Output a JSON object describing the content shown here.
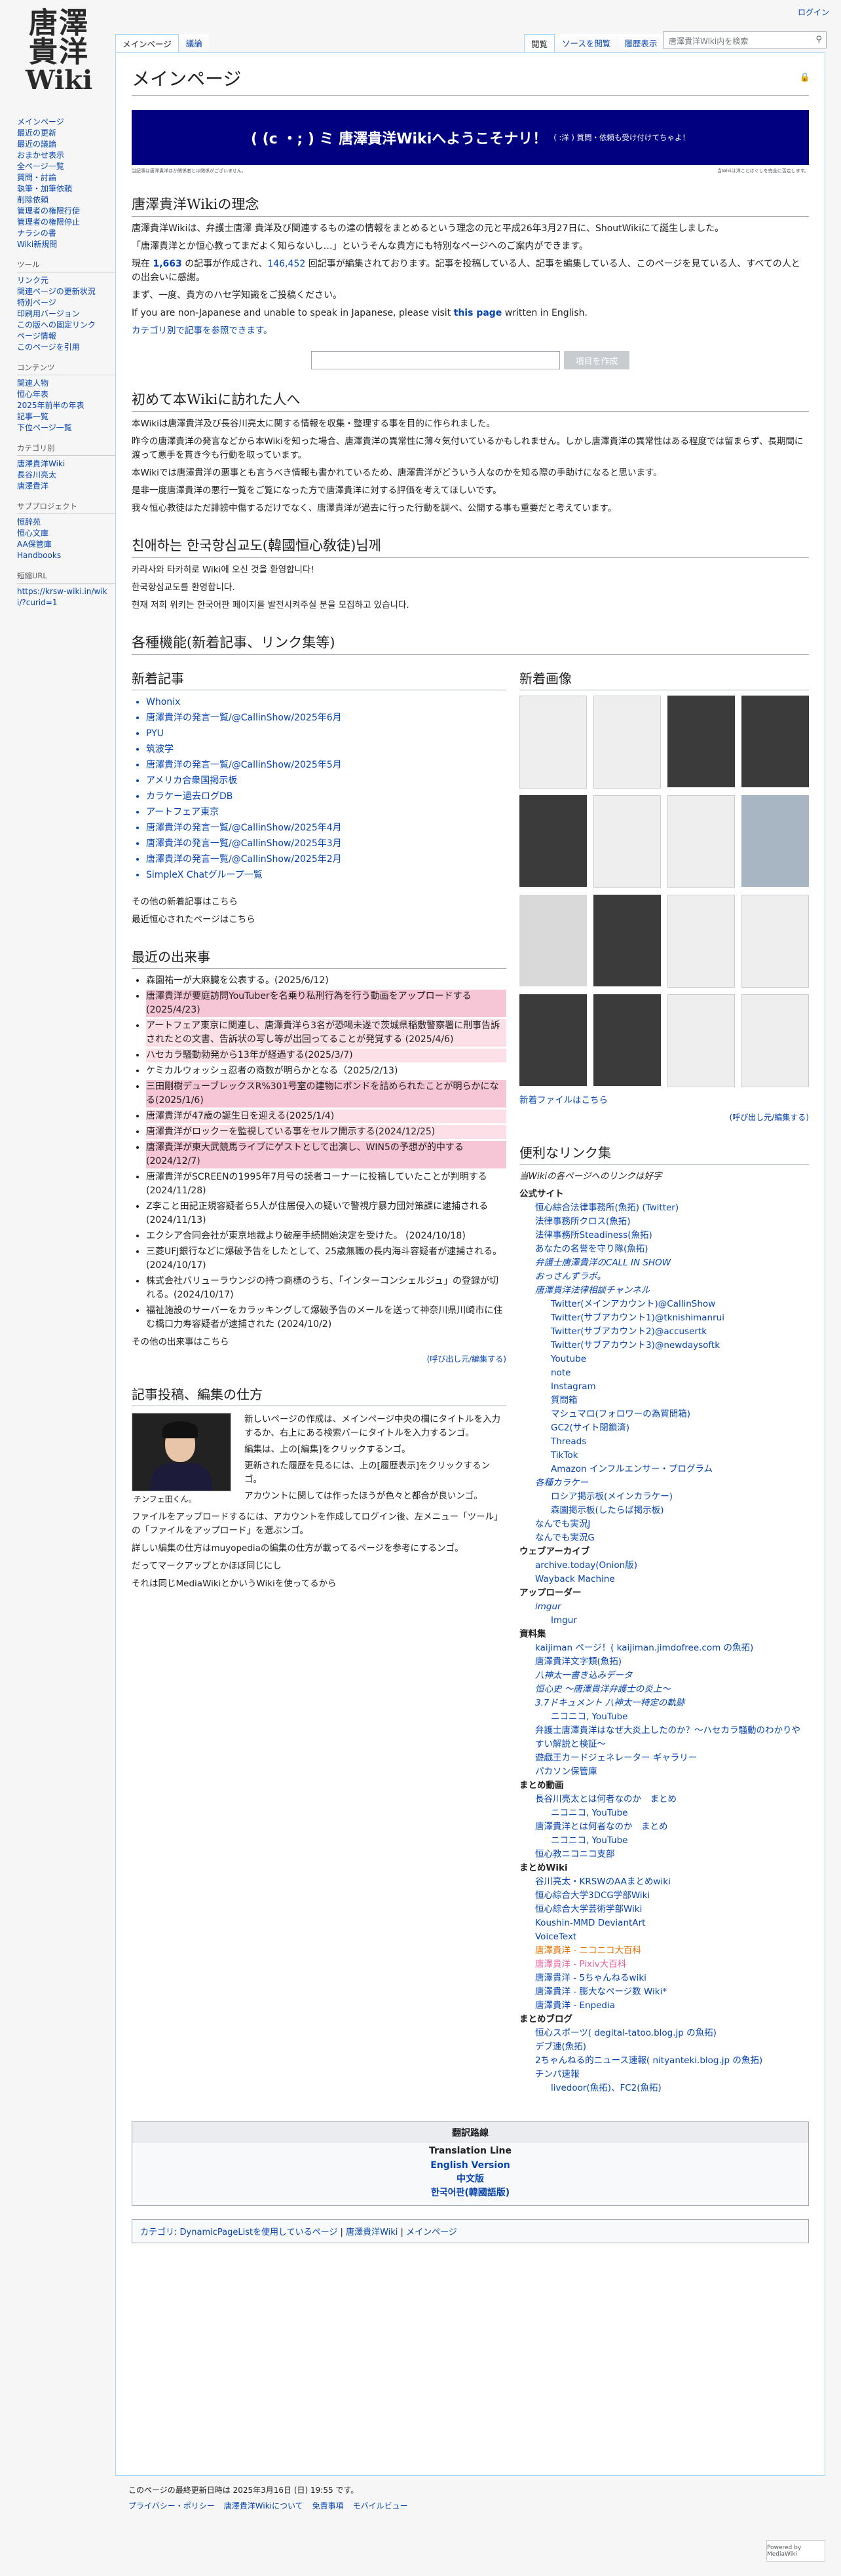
{
  "logo": {
    "line1": "唐澤",
    "line2": "貴洋",
    "line3": "Wiki"
  },
  "personal": {
    "login": "ログイン"
  },
  "tabs": {
    "left": [
      "メインページ",
      "議論"
    ],
    "right": [
      "閲覧",
      "ソースを閲覧",
      "履歴表示"
    ]
  },
  "search": {
    "placeholder": "唐澤貴洋Wiki内を検索"
  },
  "sidebar": {
    "nav": [
      "メインページ",
      "最近の更新",
      "最近の議論",
      "おまかせ表示",
      "全ページ一覧",
      "質問・討論",
      "執筆・加筆依頼",
      "削除依頼",
      "管理者の権限行使",
      "管理者の権限停止",
      "ナラシの書",
      "Wiki新規問"
    ],
    "tools_title": "ツール",
    "tools": [
      "リンク元",
      "関連ページの更新状況",
      "特別ページ",
      "印刷用バージョン",
      "この版への固定リンク",
      "ページ情報",
      "このページを引用"
    ],
    "content_title": "コンテンツ",
    "content": [
      "関連人物",
      "恒心年表",
      "2025年前半の年表",
      "記事一覧",
      "下位ページ一覧"
    ],
    "cat_title": "カテゴリ別",
    "cats": [
      "唐澤貴洋Wiki",
      "長谷川亮太",
      "唐澤貴洋"
    ],
    "sub_title": "サブプロジェクト",
    "subs": [
      "恒辞苑",
      "恒心文庫",
      "AA保管庫",
      "Handbooks"
    ],
    "short_title": "短縮URL",
    "short": "https://krsw-wiki.in/wiki/?curid=1"
  },
  "page": {
    "title": "メインページ",
    "banner_main": "( (c ・; ) ミ 唐澤貴洋Wikiへようこそナリ！",
    "banner_sub": "( :洋 ) 質問・依頼も受け付けてちゃよ！",
    "tiny_left": "当記事は唐澤貴洋ほか関係者とは関係がございません。",
    "tiny_right": "当Wikiは洋ことほぐしを完全に否定します。"
  },
  "philosophy": {
    "heading": "唐澤貴洋Wikiの理念",
    "p1": "唐澤貴洋Wikiは、弁護士唐澤 貴洋及び関連するもの達の情報をまとめるという理念の元と平成26年3月27日に、ShoutWikiにて誕生しました。",
    "p2": "「唐澤貴洋とか恒心教ってまだよく知らないし…」というそんな貴方にも特別なページへのご案内ができます。",
    "p3_a": "現在 ",
    "count_articles": "1,663",
    "p3_b": " の記事が作成され、",
    "count_edits": "146,452",
    "p3_c": " 回記事が編集されております。記事を投稿している人、記事を編集している人、このページを見ている人、すべての人との出会いに感謝。",
    "p4": "まず、一度、貴方のハセ学知識をご投稿ください。",
    "p5_a": "If you are non-Japanese and unable to speak in Japanese, please visit ",
    "p5_link": "this page",
    "p5_b": " written in English.",
    "cat_link": "カテゴリ別で記事を参照できます。",
    "create_btn": "項目を作成"
  },
  "first": {
    "heading": "初めて本Wikiに訪れた人へ",
    "p1": "本Wikiは唐澤貴洋及び長谷川亮太に関する情報を収集・整理する事を目的に作られました。",
    "p2": "昨今の唐澤貴洋の発言などから本Wikiを知った場合、唐澤貴洋の異常性に薄々気付いているかもしれません。しかし唐澤貴洋の異常性はある程度では留まらず、長期間に渡って悪手を貫き今も行動を取っています。",
    "p3": "本Wikiでは唐澤貴洋の悪事とも言うべき情報も書かれているため、唐澤貴洋がどういう人なのかを知る際の手助けになると思います。",
    "p4": "是非一度唐澤貴洋の悪行一覧をご覧になった方で唐澤貴洋に対する評価を考えてほしいです。",
    "p5": "我々恒心教徒はただ誹謗中傷するだけでなく、唐澤貴洋が過去に行った行動を調べ、公開する事も重要だと考えています。"
  },
  "korean": {
    "heading": "친애하는 한국항심교도(韓國恒心敎徒)님께",
    "p1": "카라사와 타카히로 Wiki에 오신 것을 환영합니다!",
    "p2": "한국항심교도를 환영합니다.",
    "p3": "현재 저희 위키는 한국어판 페이지를 발전시켜주실 분을 모집하고 있습니다."
  },
  "features": {
    "heading": "各種機能(新着記事、リンク集等)",
    "new_heading": "新着記事",
    "new_items": [
      "Whonix",
      "唐澤貴洋の発言一覧/@CallinShow/2025年6月",
      "PYU",
      "筑波学",
      "唐澤貴洋の発言一覧/@CallinShow/2025年5月",
      "アメリカ合衆国掲示板",
      "カラケー過去ログDB",
      "アートフェア東京",
      "唐澤貴洋の発言一覧/@CallinShow/2025年4月",
      "唐澤貴洋の発言一覧/@CallinShow/2025年3月",
      "唐澤貴洋の発言一覧/@CallinShow/2025年2月",
      "SimpleX Chatグループ一覧"
    ],
    "new_other": "その他の新着記事はこちら",
    "new_other2": "最近恒心されたページはこちら",
    "events_heading": "最近の出来事",
    "events": [
      "森園祐一が大麻臓を公表する。(2025/6/12)",
      "唐澤貴洋が要庭訪問YouTuberを名乗り私刑行為を行う動画をアップロードする (2025/4/23)",
      "アートフェア東京に関連し、唐澤貴洋ら3名が恐喝未遂で茨城県稲敷警察署に刑事告訴されたとの文書、告訴状の写し等が出回ってることが発覚する (2025/4/6)",
      "ハセカラ騒動勃発から13年が経過する(2025/3/7)",
      "ケミカルウォッシュ忍者の商数が明らかとなる（2025/2/13)",
      "三田剛樹デューブレックスR%301号室の建物にボンドを詰められたことが明らかになる(2025/1/6)",
      "唐澤貴洋が47歳の誕生日を迎える(2025/1/4)",
      "唐澤貴洋がロックーを監視している事をセルフ開示する(2024/12/25)",
      "唐澤貴洋が東大武競馬ライブにゲストとして出演し、WIN5の予想が的中する (2024/12/7)",
      "唐澤貴洋がSCREENの1995年7月号の読者コーナーに投稿していたことが判明する (2024/11/28)",
      "Z李こと田記正規容疑者ら5人が住居侵入の疑いで警視庁暴力団対策課に逮捕される (2024/11/13)",
      "エクシア合同会社が東京地裁より破産手続開始決定を受けた。 (2024/10/18)",
      "三菱UFJ銀行などに爆破予告をしたとして、25歳無職の長内海斗容疑者が逮捕される。(2024/10/17)",
      "株式会社バリューラウンジの持つ商標のうち、「インターコンシェルジュ」の登録が切れる。(2024/10/17)",
      "福祉施設のサーバーをカラッキングして爆破予告のメールを送って神奈川県川崎市に住む橋口力寿容疑者が逮捕された (2024/10/2)"
    ],
    "events_other": "その他の出来事はこちら",
    "events_edit": "(呼び出し元/編集する)",
    "howto_heading": "記事投稿、編集の仕方",
    "howto_lines": [
      "新しいページの作成は、メインページ中央の欄にタイトルを入力するか、右上にある検索バーにタイトルを入力するンゴ。",
      "編集は、上の[編集]をクリックするンゴ。",
      "更新された履歴を見るには、上の[履歴表示]をクリックするンゴ。",
      "アカウントに関しては作ったほうが色々と都合が良いンゴ。"
    ],
    "avatar_caption": "チンフェ田くん。",
    "howto_more1": "ファイルをアップロードするには、アカウントを作成してログイン後、左メニュー「ツール」の「ファイルをアップロード」を選ぶンゴ。",
    "howto_more2": "詳しい編集の仕方はmuyopediaの編集の仕方が載ってるページを参考にするンゴ。",
    "howto_more3": "だってマークアップとかほぼ同じにし",
    "howto_more4": "それは同じMediaWikiとかいうWikiを使ってるから",
    "img_heading": "新着画像",
    "img_more": "新着ファイルはこちら",
    "img_edit": "(呼び出し元/編集する)",
    "links_heading": "便利なリンク集",
    "links_sub": "当Wikiの各ページへのリンクは好字",
    "links": [
      {
        "t": "公式サイト",
        "c": "b",
        "i": 0
      },
      {
        "t": "恒心綜合法律事務所(魚拓) (Twitter)",
        "c": "",
        "i": 1
      },
      {
        "t": "法律事務所クロス(魚拓)",
        "c": "",
        "i": 1
      },
      {
        "t": "法律事務所Steadiness(魚拓)",
        "c": "",
        "i": 1
      },
      {
        "t": "あなたの名誉を守り隊(魚拓)",
        "c": "",
        "i": 1
      },
      {
        "t": "弁護士唐澤貴洋のCALL IN SHOW",
        "c": "it-i",
        "i": 1
      },
      {
        "t": "おっさんずラボ。",
        "c": "it-i",
        "i": 1
      },
      {
        "t": "唐澤貴洋法律相談チャンネル",
        "c": "it-i",
        "i": 1
      },
      {
        "t": "Twitter(メインアカウント)@CallinShow",
        "c": "",
        "i": 2
      },
      {
        "t": "Twitter(サブアカウント1)@tknishimanrui",
        "c": "",
        "i": 2
      },
      {
        "t": "Twitter(サブアカウント2)@accusertk",
        "c": "",
        "i": 2
      },
      {
        "t": "Twitter(サブアカウント3)@newdaysoftk",
        "c": "",
        "i": 2
      },
      {
        "t": "Youtube",
        "c": "",
        "i": 2
      },
      {
        "t": "note",
        "c": "",
        "i": 2
      },
      {
        "t": "Instagram",
        "c": "",
        "i": 2
      },
      {
        "t": "質問箱",
        "c": "",
        "i": 2
      },
      {
        "t": "マシュマロ(フォロワーの為質問箱)",
        "c": "",
        "i": 2
      },
      {
        "t": "GC2(サイト閉鎖済)",
        "c": "",
        "i": 2
      },
      {
        "t": "Threads",
        "c": "",
        "i": 2
      },
      {
        "t": "TikTok",
        "c": "",
        "i": 2
      },
      {
        "t": "Amazon インフルエンサー・プログラム",
        "c": "",
        "i": 2
      },
      {
        "t": "各種カラケー",
        "c": "it-i",
        "i": 1
      },
      {
        "t": "ロシア掲示板(メインカラケー)",
        "c": "",
        "i": 2
      },
      {
        "t": "森園掲示板(したらば掲示板)",
        "c": "",
        "i": 2
      },
      {
        "t": "なんでも実況J",
        "c": "",
        "i": 1
      },
      {
        "t": "なんでも実況G",
        "c": "",
        "i": 1
      },
      {
        "t": "ウェブアーカイブ",
        "c": "b",
        "i": 0
      },
      {
        "t": "archive.today(Onion版)",
        "c": "",
        "i": 1
      },
      {
        "t": "Wayback Machine",
        "c": "",
        "i": 1
      },
      {
        "t": "アップローダー",
        "c": "b",
        "i": 0
      },
      {
        "t": "imgur",
        "c": "it-i",
        "i": 1
      },
      {
        "t": "Imgur",
        "c": "",
        "i": 2
      },
      {
        "t": "資料集",
        "c": "b",
        "i": 0
      },
      {
        "t": "kaijiman ページ！( kaijiman.jimdofree.com の魚拓)",
        "c": "",
        "i": 1
      },
      {
        "t": "唐澤貴洋文字類(魚拓)",
        "c": "",
        "i": 1
      },
      {
        "t": "八神太一書き込みデータ",
        "c": "it-i",
        "i": 1
      },
      {
        "t": "恒心史 〜唐澤貴洋弁護士の炎上〜",
        "c": "it-i",
        "i": 1
      },
      {
        "t": "3.7ドキュメント 八神太一特定の軌跡",
        "c": "it-i",
        "i": 1
      },
      {
        "t": "ニコニコ, YouTube",
        "c": "",
        "i": 2
      },
      {
        "t": "弁護士唐澤貴洋はなぜ大炎上したのか？〜ハセカラ騒動のわかりやすい解説と検証〜",
        "c": "",
        "i": 1
      },
      {
        "t": "遊戯王カードジェネレーター ギャラリー",
        "c": "",
        "i": 1
      },
      {
        "t": "パカソン保管庫",
        "c": "",
        "i": 1
      },
      {
        "t": "まとめ動画",
        "c": "b",
        "i": 0
      },
      {
        "t": "長谷川亮太とは何者なのか　まとめ",
        "c": "",
        "i": 1
      },
      {
        "t": "ニコニコ, YouTube",
        "c": "",
        "i": 2
      },
      {
        "t": "唐澤貴洋とは何者なのか　まとめ",
        "c": "",
        "i": 1
      },
      {
        "t": "ニコニコ, YouTube",
        "c": "",
        "i": 2
      },
      {
        "t": "恒心教ニコニコ支部",
        "c": "",
        "i": 1
      },
      {
        "t": "まとめWiki",
        "c": "b",
        "i": 0
      },
      {
        "t": "谷川亮太・KRSWのAAまとめwiki",
        "c": "",
        "i": 1
      },
      {
        "t": "恒心綜合大学3DCG学部Wiki",
        "c": "",
        "i": 1
      },
      {
        "t": "恒心綜合大学芸術学部Wiki",
        "c": "",
        "i": 1
      },
      {
        "t": "Koushin-MMD DeviantArt",
        "c": "",
        "i": 1
      },
      {
        "t": "VoiceText",
        "c": "",
        "i": 1
      },
      {
        "t": "唐澤貴洋 - ニコニコ大百科",
        "c": "orange",
        "i": 1
      },
      {
        "t": "唐澤貴洋 - Pixiv大百科",
        "c": "pink",
        "i": 1
      },
      {
        "t": "唐澤貴洋 - 5ちゃんねるwiki",
        "c": "",
        "i": 1
      },
      {
        "t": "唐澤貴洋 - 膨大なページ数 Wiki*",
        "c": "",
        "i": 1
      },
      {
        "t": "唐澤貴洋 - Enpedia",
        "c": "",
        "i": 1
      },
      {
        "t": "まとめブログ",
        "c": "b",
        "i": 0
      },
      {
        "t": "恒心スポーツ( degital-tatoo.blog.jp の魚拓)",
        "c": "",
        "i": 1
      },
      {
        "t": "デブ速(魚拓)",
        "c": "",
        "i": 1
      },
      {
        "t": "2ちゃんねる的ニュース速報( nityanteki.blog.jp の魚拓)",
        "c": "",
        "i": 1
      },
      {
        "t": "チンパ速報",
        "c": "",
        "i": 1
      },
      {
        "t": "livedoor(魚拓)、FC2(魚拓)",
        "c": "",
        "i": 2
      }
    ]
  },
  "translation": {
    "title": "翻訳路線",
    "sub": "Translation Line",
    "langs": [
      "English Version",
      "中文版",
      "한국어판(韓國語版)"
    ]
  },
  "catlinks": {
    "label": "カテゴリ",
    "items": [
      "DynamicPageListを使用しているページ",
      "唐澤貴洋Wiki",
      "メインページ"
    ]
  },
  "footer": {
    "last_mod": "このページの最終更新日時は 2025年3月16日 (日) 19:55 です。",
    "links": [
      "プライバシー・ポリシー",
      "唐澤貴洋Wikiについて",
      "免責事項",
      "モバイルビュー"
    ],
    "powered": "Powered by MediaWiki"
  }
}
